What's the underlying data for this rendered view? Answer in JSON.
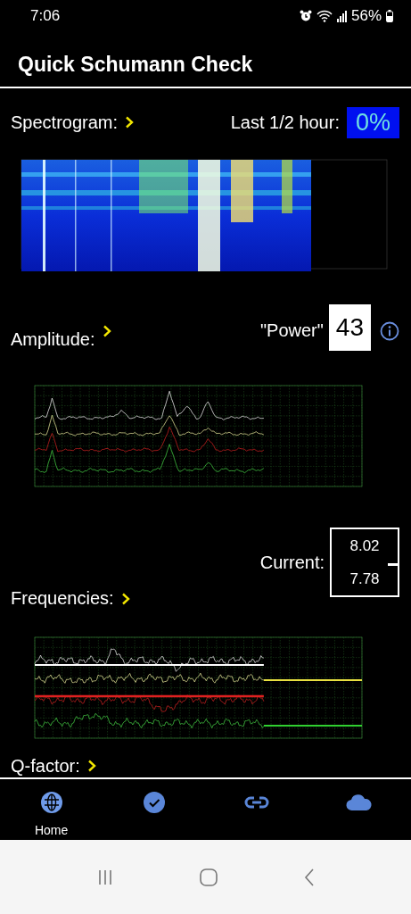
{
  "status_bar": {
    "time": "7:06",
    "battery": "56%"
  },
  "title": "Quick Schumann Check",
  "spectrogram": {
    "label": "Spectrogram:",
    "last_label": "Last 1/2 hour:",
    "last_value": "0%"
  },
  "amplitude": {
    "label": "Amplitude:",
    "power_label": "\"Power\"",
    "power_value": "43"
  },
  "frequencies": {
    "label": "Frequencies:",
    "current_label": "Current:",
    "current_values": [
      "8.02",
      "7.78"
    ]
  },
  "q_factor": {
    "label": "Q-factor:"
  },
  "nav": [
    {
      "label": "Home",
      "selected": true
    },
    {
      "selected": false
    },
    {
      "selected": false
    },
    {
      "selected": false
    }
  ]
}
